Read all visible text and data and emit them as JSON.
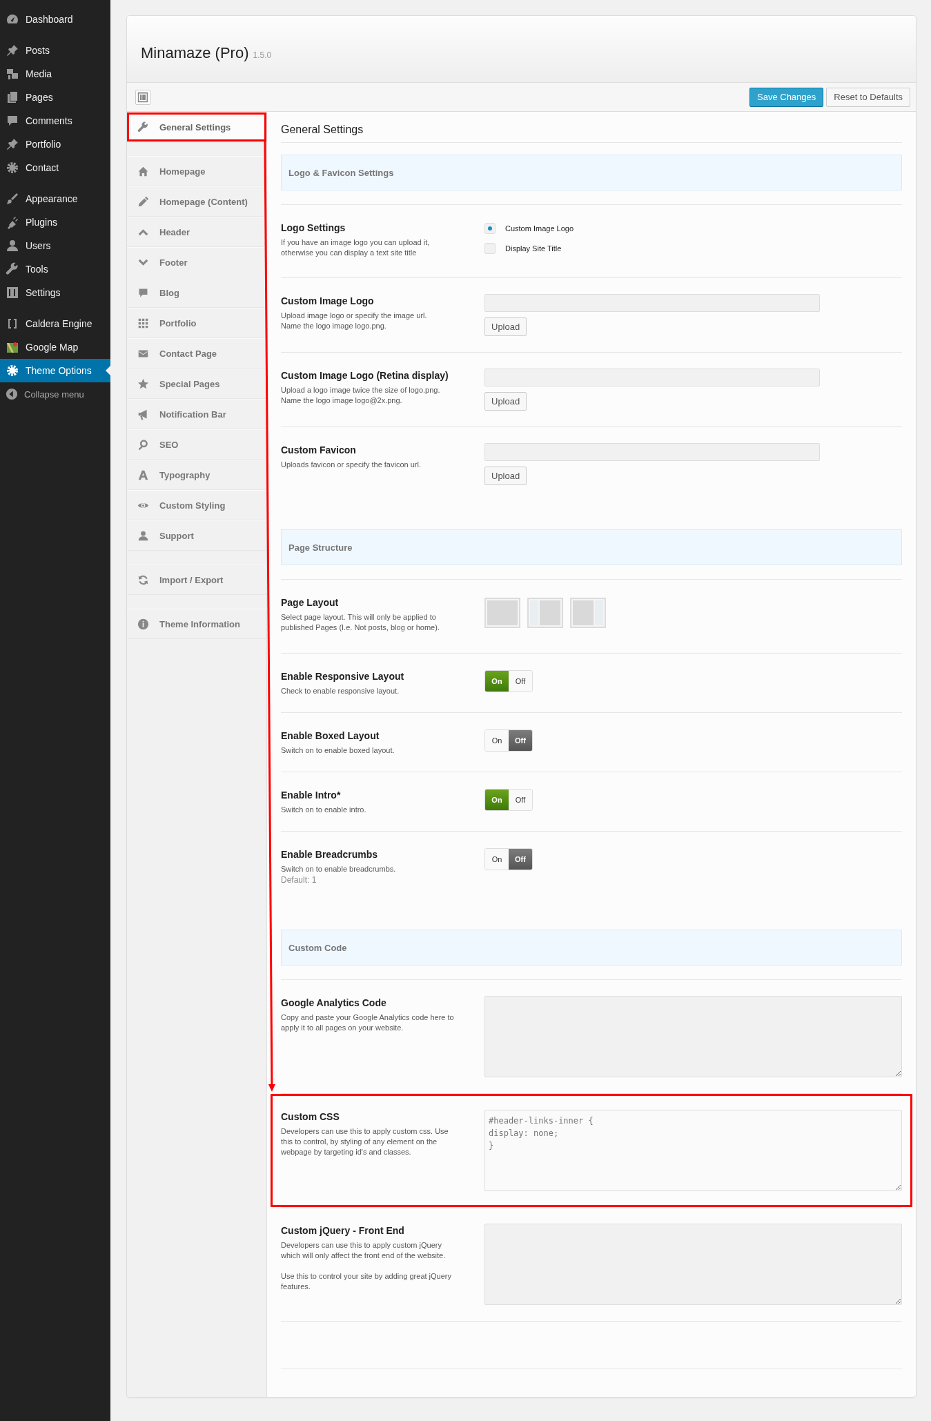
{
  "admin_menu": {
    "groups": [
      [
        {
          "label": "Dashboard",
          "selected": false
        }
      ],
      [
        {
          "label": "Posts",
          "selected": false
        },
        {
          "label": "Media",
          "selected": false
        },
        {
          "label": "Pages",
          "selected": false
        },
        {
          "label": "Comments",
          "selected": false
        },
        {
          "label": "Portfolio",
          "selected": false
        },
        {
          "label": "Contact",
          "selected": false
        }
      ],
      [
        {
          "label": "Appearance",
          "selected": false
        },
        {
          "label": "Plugins",
          "selected": false
        },
        {
          "label": "Users",
          "selected": false
        },
        {
          "label": "Tools",
          "selected": false
        },
        {
          "label": "Settings",
          "selected": false
        }
      ],
      [
        {
          "label": "Caldera Engine",
          "selected": false
        },
        {
          "label": "Google Map",
          "selected": false
        },
        {
          "label": "Theme Options",
          "selected": true
        }
      ]
    ],
    "collapse": "Collapse menu"
  },
  "options_panel": {
    "title": "Minamaze (Pro)",
    "version": "1.5.0",
    "buttons": [
      {
        "label": "Save Changes",
        "kind": "primary"
      },
      {
        "label": "Reset to Defaults",
        "kind": "secondary"
      }
    ]
  },
  "subnav": {
    "groups": [
      [
        {
          "label": "General Settings",
          "selected": true,
          "highlighted": true
        }
      ],
      [
        {
          "label": "Homepage",
          "selected": false,
          "highlighted": false
        },
        {
          "label": "Homepage (Content)",
          "selected": false,
          "highlighted": false
        },
        {
          "label": "Header",
          "selected": false,
          "highlighted": false
        },
        {
          "label": "Footer",
          "selected": false,
          "highlighted": false
        },
        {
          "label": "Blog",
          "selected": false,
          "highlighted": false
        },
        {
          "label": "Portfolio",
          "selected": false,
          "highlighted": false
        },
        {
          "label": "Contact Page",
          "selected": false,
          "highlighted": false
        },
        {
          "label": "Special Pages",
          "selected": false,
          "highlighted": false
        },
        {
          "label": "Notification Bar",
          "selected": false,
          "highlighted": false
        },
        {
          "label": "SEO",
          "selected": false,
          "highlighted": false
        },
        {
          "label": "Typography",
          "selected": false,
          "highlighted": false
        },
        {
          "label": "Custom Styling",
          "selected": false,
          "highlighted": false
        },
        {
          "label": "Support",
          "selected": false,
          "highlighted": false
        }
      ],
      [
        {
          "label": "Import / Export",
          "selected": false,
          "highlighted": false
        }
      ],
      [
        {
          "label": "Theme Information",
          "selected": false,
          "highlighted": false
        }
      ]
    ]
  },
  "content": {
    "heading": "General Settings",
    "sections": [
      {
        "title": "Logo & Favicon Settings",
        "fields": [
          {
            "kind": "radio",
            "title": "Logo Settings",
            "description": "If you have an image logo you can upload it,\notherwise you can display a text site title",
            "highlighted": false,
            "options": [
              {
                "label": "Custom Image Logo",
                "selected": true
              },
              {
                "label": "Display Site Title",
                "selected": false
              }
            ]
          },
          {
            "kind": "upload",
            "title": "Custom Image Logo",
            "description": "Upload image logo or specify the image url.\nName the logo image logo.png.",
            "highlighted": false,
            "button": "Upload"
          },
          {
            "kind": "upload",
            "title": "Custom Image Logo (Retina display)",
            "description": "Upload a logo image twice the size of logo.png.\nName the logo image logo@2x.png.",
            "highlighted": false,
            "button": "Upload"
          },
          {
            "kind": "upload",
            "title": "Custom Favicon",
            "description": "Uploads favicon or specify the favicon url.",
            "highlighted": false,
            "button": "Upload"
          }
        ]
      },
      {
        "title": "Page Structure",
        "fields": [
          {
            "kind": "layout",
            "title": "Page Layout",
            "description": "Select page layout. This will only be applied to\npublished Pages (I.e. Not posts, blog or home).",
            "highlighted": false,
            "options": [
              {
                "kind": "full"
              },
              {
                "kind": "sidebar-left"
              },
              {
                "kind": "sidebar-right"
              }
            ]
          },
          {
            "kind": "toggle",
            "title": "Enable Responsive Layout",
            "description": "Check to enable responsive layout.",
            "highlighted": false,
            "on": true,
            "on_label": "On",
            "off_label": "Off"
          },
          {
            "kind": "toggle",
            "title": "Enable Boxed Layout",
            "description": "Switch on to enable boxed layout.",
            "highlighted": false,
            "on": false,
            "on_label": "On",
            "off_label": "Off"
          },
          {
            "kind": "toggle",
            "title": "Enable Intro*",
            "description": "Switch on to enable intro.",
            "highlighted": false,
            "on": true,
            "on_label": "On",
            "off_label": "Off"
          },
          {
            "kind": "toggle",
            "title": "Enable Breadcrumbs",
            "description": "Switch on to enable breadcrumbs.",
            "note": "Default: 1",
            "highlighted": false,
            "on": false,
            "on_label": "On",
            "off_label": "Off"
          }
        ]
      },
      {
        "title": "Custom Code",
        "fields": [
          {
            "kind": "textarea",
            "title": "Google Analytics Code",
            "description": "Copy and paste your Google Analytics code here to\napply it to all pages on your website.",
            "highlighted": false
          },
          {
            "kind": "textarea",
            "title": "Custom CSS",
            "description": "Developers can use this to apply custom css. Use\nthis to control, by styling of any element on the\nwebpage by targeting id's and classes.",
            "highlighted": true,
            "value": "#header-links-inner {\ndisplay: none;\n}"
          },
          {
            "kind": "textarea",
            "title": "Custom jQuery - Front End",
            "description": "Developers can use this to apply custom jQuery\nwhich will only affect the front end of the website.\n\nUse this to control your site by adding great jQuery\nfeatures.",
            "highlighted": false
          }
        ]
      }
    ]
  }
}
